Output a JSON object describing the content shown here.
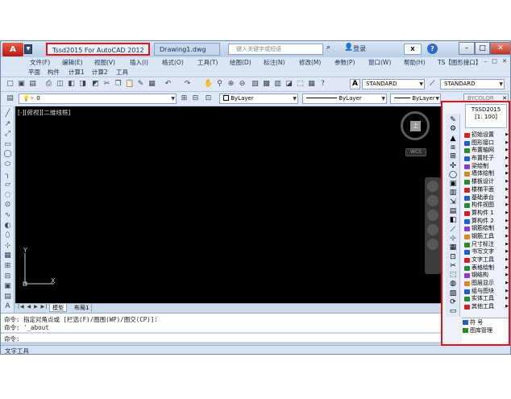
{
  "titlebar": {
    "tab_active": "Tssd2015 For AutoCAD 2012",
    "tab_drawing": "Drawing1.dwg",
    "search_placeholder": "键入关键字或短语",
    "login": "登录",
    "exchange": "X"
  },
  "menus": [
    "文件(F)",
    "编辑(E)",
    "视图(V)",
    "插入(I)",
    "格式(O)",
    "工具(T)",
    "绘图(D)",
    "标注(N)",
    "修改(M)",
    "参数(P)",
    "窗口(W)",
    "帮助(H)",
    "TS【图形接口】"
  ],
  "menus2": [
    "平面",
    "构件",
    "计算1",
    "计算2",
    "工具"
  ],
  "toolbar1": {
    "text_style": "STANDARD",
    "dim_style": "STANDARD"
  },
  "toolbar2": {
    "layer": "0",
    "color": "ByLayer",
    "linetype": "ByLayer",
    "lineweight": "ByLayer",
    "plot_style": "BYCOLOR"
  },
  "canvas": {
    "viewport_label": "[-][俯视][二维线框]",
    "viewcube_top": "上",
    "wcs": "WCS",
    "axis_y": "Y",
    "axis_x": "X"
  },
  "layout_tabs": {
    "nav": "|◀ ◀ ▶ ▶|",
    "model": "模型",
    "layout1": "布局1"
  },
  "command": {
    "line1": "命令: 指定对角点或 [栏选(F)/圈围(WP)/圈交(CP)]:",
    "line2": "命令: '_about",
    "prompt": "命令:"
  },
  "status_text": "文字工具",
  "panel": {
    "title": "TSSD2015",
    "scale": "[1: 100]",
    "items": [
      {
        "label": "初始设置",
        "color": "#d42020"
      },
      {
        "label": "图形接口",
        "color": "#1f5fc8"
      },
      {
        "label": "布置轴网",
        "color": "#2c8a2c"
      },
      {
        "label": "布置柱子",
        "color": "#1f5fc8"
      },
      {
        "label": "梁绘制",
        "color": "#8a3ac8"
      },
      {
        "label": "墙体绘制",
        "color": "#d48a20"
      },
      {
        "label": "楼板设计",
        "color": "#2c8a2c"
      },
      {
        "label": "楼梯平面",
        "color": "#d42020"
      },
      {
        "label": "基础承台",
        "color": "#1f5fc8"
      },
      {
        "label": "构件视图",
        "color": "#2c8a2c"
      },
      {
        "label": "算构件 1",
        "color": "#d42020"
      },
      {
        "label": "算构件 2",
        "color": "#1f5fc8"
      },
      {
        "label": "钢筋绘制",
        "color": "#8a3ac8"
      },
      {
        "label": "钢筋工具",
        "color": "#d48a20"
      },
      {
        "label": "尺寸标注",
        "color": "#2c8a2c"
      },
      {
        "label": "书写文字",
        "color": "#1f5fc8"
      },
      {
        "label": "文字工具",
        "color": "#d42020"
      },
      {
        "label": "表格绘制",
        "color": "#2c8a2c"
      },
      {
        "label": "钢结构",
        "color": "#8a3ac8"
      },
      {
        "label": "图层显示",
        "color": "#d48a20"
      },
      {
        "label": "组与图块",
        "color": "#1f5fc8"
      },
      {
        "label": "实体工具",
        "color": "#2c8a2c"
      },
      {
        "label": "其他工具",
        "color": "#d42020"
      }
    ],
    "bottom_items": [
      {
        "label": "符 号",
        "color": "#1f5fc8"
      },
      {
        "label": "图库管理",
        "color": "#2c8a2c"
      }
    ]
  }
}
